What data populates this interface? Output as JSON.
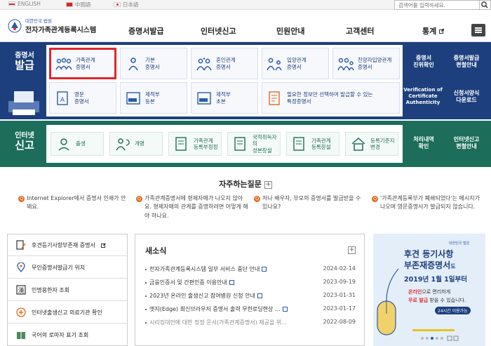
{
  "topbar": {
    "langs": [
      "ENGLISH",
      "中國語",
      "日本語"
    ],
    "search_placeholder": "검색어를 입력하세요."
  },
  "header": {
    "logo_small": "대한민국 법원",
    "logo_title": "전자가족관계등록시스템",
    "nav": [
      "증명서발급",
      "인터넷신고",
      "민원안내",
      "고객센터",
      "통계"
    ]
  },
  "cert": {
    "title_line1": "증명서",
    "title_line2": "발급",
    "row1": [
      "가족관계\n증명서",
      "기본\n증명서",
      "혼인관계\n증명서",
      "입양관계\n증명서",
      "친양자입양관계\n증명서"
    ],
    "row2": [
      "영문\n증명서",
      "제적부\n등본",
      "제적부\n초본",
      "필요한 정보만 선택하여 발급할 수 있는\n특정증명서"
    ],
    "side1": "증명서\n진위확인",
    "side2": "증명서발급\n편철안내",
    "side3": "Verification of\nCertificate\nAuthenticity",
    "side4": "신청서양식\n다운로드"
  },
  "report": {
    "title_line1": "인터넷",
    "title_line2": "신고",
    "items": [
      "출생",
      "개명",
      "가족관계\n등록부정정",
      "국적취득자의\n성본창설",
      "가족관계\n등록창설",
      "등록기준지\n변경"
    ],
    "side1": "처리내역\n확인",
    "side2": "인터넷신고\n편철안내"
  },
  "faq": {
    "title": "자주하는질문",
    "plus": "+",
    "items": [
      "Internet Explorer에서 증명서 인쇄가 안돼요.",
      "가족관계증명서에 형제자매가 나오지 않아요. 형제자매의 관계를 증명하려면 어떻게 해야 하나요.",
      "저나 배우자, 부모의 증명서를 발급받을 수 있나요?",
      "'가족관계등록부가 폐쇄되었다'는 메시지가 나오며 영문증명서가 발급되지 않습니다."
    ]
  },
  "links": [
    "후견등기사항부존재 증명서",
    "무인증명서발급기 위치",
    "인명용한자 조회",
    "인터넷출생신고 의료기관 확인",
    "국어의 로마자 표기 조회"
  ],
  "news": {
    "title": "새소식",
    "plus": "+",
    "items": [
      {
        "title": "전자가족관계등록시스템 일부 서비스 중단 안내",
        "date": "2024-02-14"
      },
      {
        "title": "금융인증서 및 간편인증 이용안내",
        "date": "2023-09-19"
      },
      {
        "title": "2023년 온라인 출생신고 참여병원 신청 안내",
        "date": "2023-01-31"
      },
      {
        "title": "엣지(Edge) 최신브라우저 증명서 출력 무한로딩현상 ...",
        "date": "2023-01-17"
      },
      {
        "title": "시리킹대인에 대한 정정 문서(가족관계증명서) 제공을 위...",
        "date": "2022-08-09"
      }
    ]
  },
  "banner": {
    "seal": "대한민국 법원",
    "line1": "후견 등기사항",
    "line2": "부존재증명서",
    "line2b": "도",
    "line3a": "2019년 1월 1일부터",
    "line4a": "온라인",
    "line4b": "으로 편리하게",
    "line5a": "무료 발급",
    "line5b": "받을 수 있습니다.",
    "badge": "24시간 이용가능"
  },
  "colors": {
    "cert_bg": "#1d3f7d",
    "report_bg": "#1c6e5a",
    "highlight": "#e0262b"
  }
}
